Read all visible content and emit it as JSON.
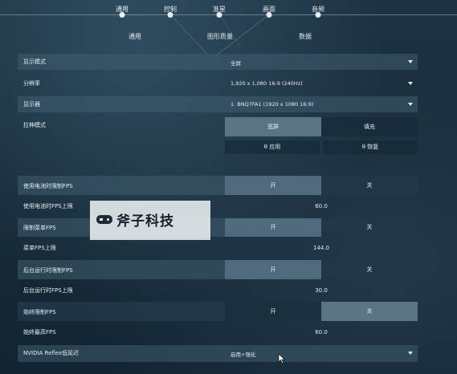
{
  "top_nav": {
    "items": [
      {
        "label": "通用"
      },
      {
        "label": "控制"
      },
      {
        "label": "准星"
      },
      {
        "label": "画面"
      },
      {
        "label": "音频"
      }
    ]
  },
  "sub_tabs": [
    {
      "label": "通用"
    },
    {
      "label": "图形质量"
    },
    {
      "label": "数据"
    }
  ],
  "settings": {
    "display_mode": {
      "label": "显示模式",
      "value": "全屏"
    },
    "resolution": {
      "label": "分辨率",
      "value": "1,920 x 1,080 16:9 (240Hz)"
    },
    "monitor": {
      "label": "显示器",
      "value": "1. BNQ7FA1 (1920 x 1080 16:9)"
    },
    "stretch_mode": {
      "label": "拉伸模式",
      "options": [
        "宽屏",
        "填充"
      ],
      "selected": "宽屏"
    },
    "apply_label": "θ 应用",
    "restore_label": "θ 恢复",
    "battery_limit_fps": {
      "label": "使用电池时限制FPS",
      "options": [
        "开",
        "关"
      ],
      "selected": "开"
    },
    "battery_fps_cap": {
      "label": "使用电池时FPS上限",
      "value": "60.0"
    },
    "menu_limit_fps": {
      "label": "限制菜单FPS",
      "options": [
        "开",
        "关"
      ],
      "selected": "开"
    },
    "menu_fps_cap": {
      "label": "菜单FPS上限",
      "value": "144.0"
    },
    "background_limit_fps": {
      "label": "后台运行时限制FPS",
      "options": [
        "开",
        "关"
      ],
      "selected": "开"
    },
    "background_fps_cap": {
      "label": "后台运行时FPS上限",
      "value": "30.0"
    },
    "always_limit_fps": {
      "label": "始终限制FPS",
      "options": [
        "开",
        "关"
      ],
      "selected": "关"
    },
    "always_fps_max": {
      "label": "始终最高FPS",
      "value": "60.0"
    },
    "nvidia_reflex": {
      "label": "NVIDIA Reflex低延迟",
      "value": "启用+强化"
    }
  },
  "watermark": {
    "text": "斧子科技"
  }
}
